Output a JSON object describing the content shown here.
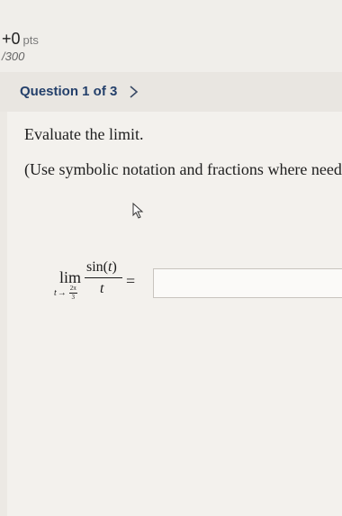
{
  "score": {
    "value": "+0",
    "unit": "pts",
    "max": "/300"
  },
  "question_nav": {
    "title": "Question 1 of 3",
    "next_icon": "chevron-right-icon"
  },
  "question": {
    "prompt": "Evaluate the limit.",
    "instruction": "(Use symbolic notation and fractions where neede",
    "math": {
      "operator": "lim",
      "variable": "t",
      "arrow": "→",
      "approach_numerator": "2π",
      "approach_denominator": "3",
      "numerator_func": "sin(",
      "numerator_var": "t",
      "numerator_close": ")",
      "denominator": "t",
      "equals": "="
    },
    "answer": {
      "value": ""
    }
  },
  "colors": {
    "question_title": "#24406b",
    "background": "#ece9e4"
  }
}
